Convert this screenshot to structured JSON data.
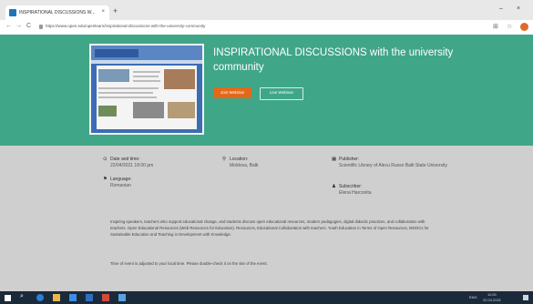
{
  "browser": {
    "tab_title": "INSPIRATIONAL DISCUSSIONS W...",
    "tab_close": "×",
    "new_tab": "+",
    "window_controls": [
      "–",
      "×"
    ],
    "nav_back": "←",
    "nav_forward": "→",
    "nav_reload": "C",
    "url": "https://www.open.edu/openlearn/inspirational-discussions-with-the-university-community"
  },
  "hero": {
    "title": "INSPIRATIONAL DISCUSSIONS with the university community",
    "join_label": "Join Webinar",
    "watch_label": "Live Webinar",
    "accent": "#40a688",
    "button_color": "#e06a1a"
  },
  "details": {
    "date_label": "Date and time:",
    "date_value": "22/04/2021 18:00 pm",
    "location_label": "Location:",
    "location_value": "Moldova, Balti",
    "publisher_label": "Publisher:",
    "publisher_value": "Scientific Library of Alecu Russo Balti State University",
    "language_label": "Language:",
    "language_value": "Romanian",
    "subscriber_label": "Subscriber:",
    "subscriber_value": "Elena Harconita"
  },
  "description": "Inspiring speakers, teachers who support educational change, and students discuss open educational resources, modern pedagogies, digital didactic practices, and collaboration with teachers. Open Educational Resources (Web Resources for Education). Resources, Educational Collaboration with teachers. Youth Education in Terms of Open Resources, MOOCs for Sustainable Education and Teaching in Development with Knowledge.",
  "timezone_note": "Time of event is adjusted to your local time. Please double-check it on the site of the event.",
  "taskbar": {
    "tray_text": "ENG",
    "time": "11:00",
    "date": "22.04.2021"
  }
}
